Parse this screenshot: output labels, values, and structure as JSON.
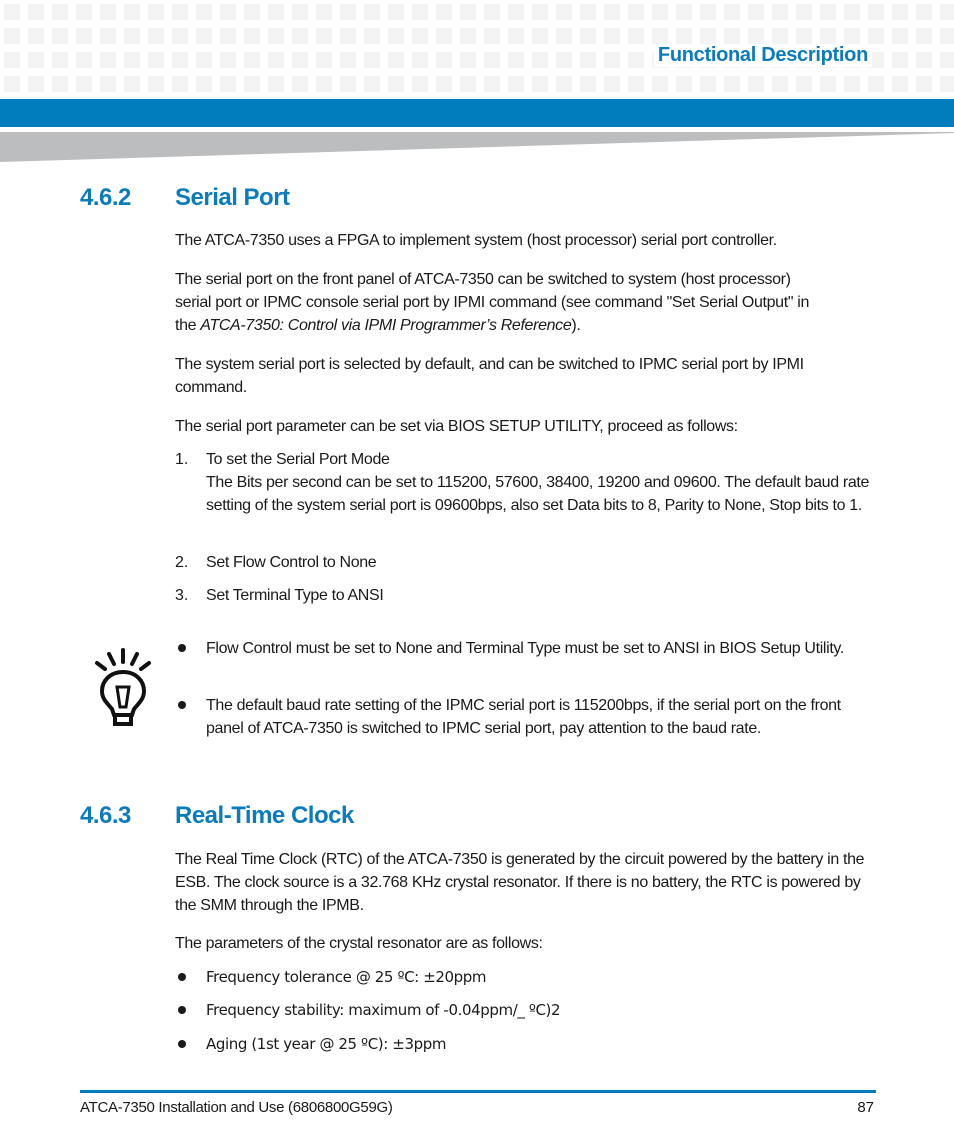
{
  "header": {
    "chapter_title": "Functional Description"
  },
  "sections": [
    {
      "number": "4.6.2",
      "title": "Serial Port",
      "paragraphs": [
        "The ATCA-7350 uses a FPGA to implement system (host processor) serial port controller.",
        {
          "line1": "The serial port on the front panel of ATCA-7350 can be switched to system (host processor)",
          "line2": "serial port or IPMC console serial port by IPMI command (see command \"Set Serial Output\" in",
          "line3_prefix": "the ",
          "line3_italic": "ATCA-7350: Control via IPMI Programmer’s Reference",
          "line3_suffix": ")."
        },
        "The system serial port is selected by default, and can be switched to IPMC serial port by IPMI command.",
        "The serial port parameter can be set via BIOS SETUP UTILITY, proceed as follows:"
      ],
      "steps": [
        {
          "number": "1.",
          "title": "To set the Serial Port Mode",
          "detail": "The Bits per second can be set to 115200, 57600, 38400, 19200 and 09600. The default baud rate setting of the system serial port is 09600bps, also set Data bits to 8, Parity to None, Stop bits to 1."
        },
        {
          "number": "2.",
          "title": "Set Flow Control to None"
        },
        {
          "number": "3.",
          "title": "Set Terminal Type to ANSI"
        }
      ],
      "tip": {
        "icon": "lightbulb-icon",
        "bullets": [
          "Flow Control must be set to None and Terminal Type must be set to ANSI in BIOS Setup Utility.",
          "The default baud rate setting of the IPMC serial port is 115200bps, if the serial port on the front panel of ATCA-7350 is switched to IPMC serial port, pay attention to the baud rate."
        ]
      }
    },
    {
      "number": "4.6.3",
      "title": "Real-Time Clock",
      "paragraphs": [
        "The Real Time Clock (RTC) of the ATCA-7350 is generated by the circuit powered by the battery in the ESB. The clock source is a 32.768 KHz crystal resonator. If there is no battery, the RTC is powered by the SMM through the IPMB.",
        "The parameters of the crystal resonator are as follows:"
      ],
      "bullets": [
        "Frequency tolerance @ 25 ºC: ±20ppm",
        "Frequency stability: maximum of -0.04ppm/_ ºC)2",
        "Aging (1st year @ 25 ºC): ±3ppm"
      ]
    }
  ],
  "footer": {
    "document_title": "ATCA-7350 Installation and Use (6806800G59G)",
    "page_number": "87"
  },
  "colors": {
    "accent_blue": "#017cbc",
    "heading_blue": "#0a7cbe",
    "wedge_gray": "#bcbdbf",
    "pattern_gray": "#f4f4f4"
  }
}
